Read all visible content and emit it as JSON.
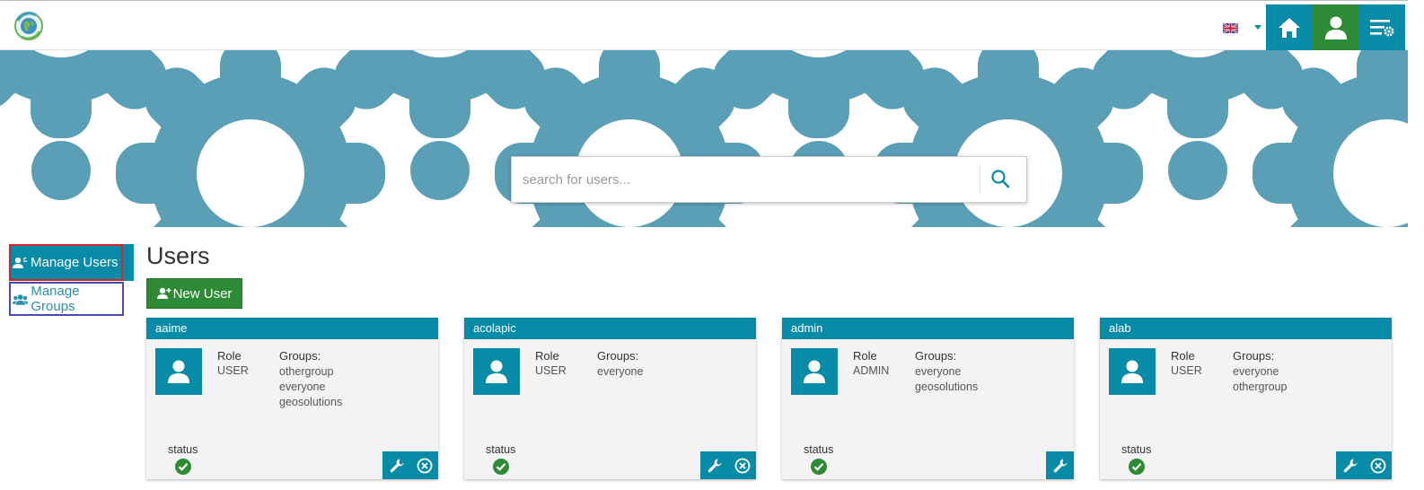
{
  "nav": {
    "language": "en",
    "language_icon": "uk-flag-icon",
    "buttons": [
      "home-icon",
      "user-icon",
      "settings-menu-icon"
    ]
  },
  "search": {
    "placeholder": "search for users..."
  },
  "sidebar": {
    "items": [
      {
        "label": "Manage Users",
        "icon": "users-icon",
        "active": true
      },
      {
        "label": "Manage Groups",
        "icon": "groups-icon",
        "active": false
      }
    ]
  },
  "main": {
    "title": "Users",
    "new_user_label": "New User"
  },
  "cards": [
    {
      "name": "aaime",
      "role_label": "Role",
      "role": "USER",
      "groups_label": "Groups:",
      "groups": [
        "othergroup",
        "everyone",
        "geosolutions"
      ],
      "status_label": "status",
      "actions": [
        "edit",
        "delete"
      ]
    },
    {
      "name": "acolapic",
      "role_label": "Role",
      "role": "USER",
      "groups_label": "Groups:",
      "groups": [
        "everyone"
      ],
      "status_label": "status",
      "actions": [
        "edit",
        "delete"
      ]
    },
    {
      "name": "admin",
      "role_label": "Role",
      "role": "ADMIN",
      "groups_label": "Groups:",
      "groups": [
        "everyone",
        "geosolutions"
      ],
      "status_label": "status",
      "actions": [
        "edit"
      ]
    },
    {
      "name": "alab",
      "role_label": "Role",
      "role": "USER",
      "groups_label": "Groups:",
      "groups": [
        "everyone",
        "othergroup"
      ],
      "status_label": "status",
      "actions": [
        "edit",
        "delete"
      ]
    }
  ],
  "colors": {
    "primary": "#078ba6",
    "success": "#2e8b35",
    "hero": "#5b9fb7"
  }
}
